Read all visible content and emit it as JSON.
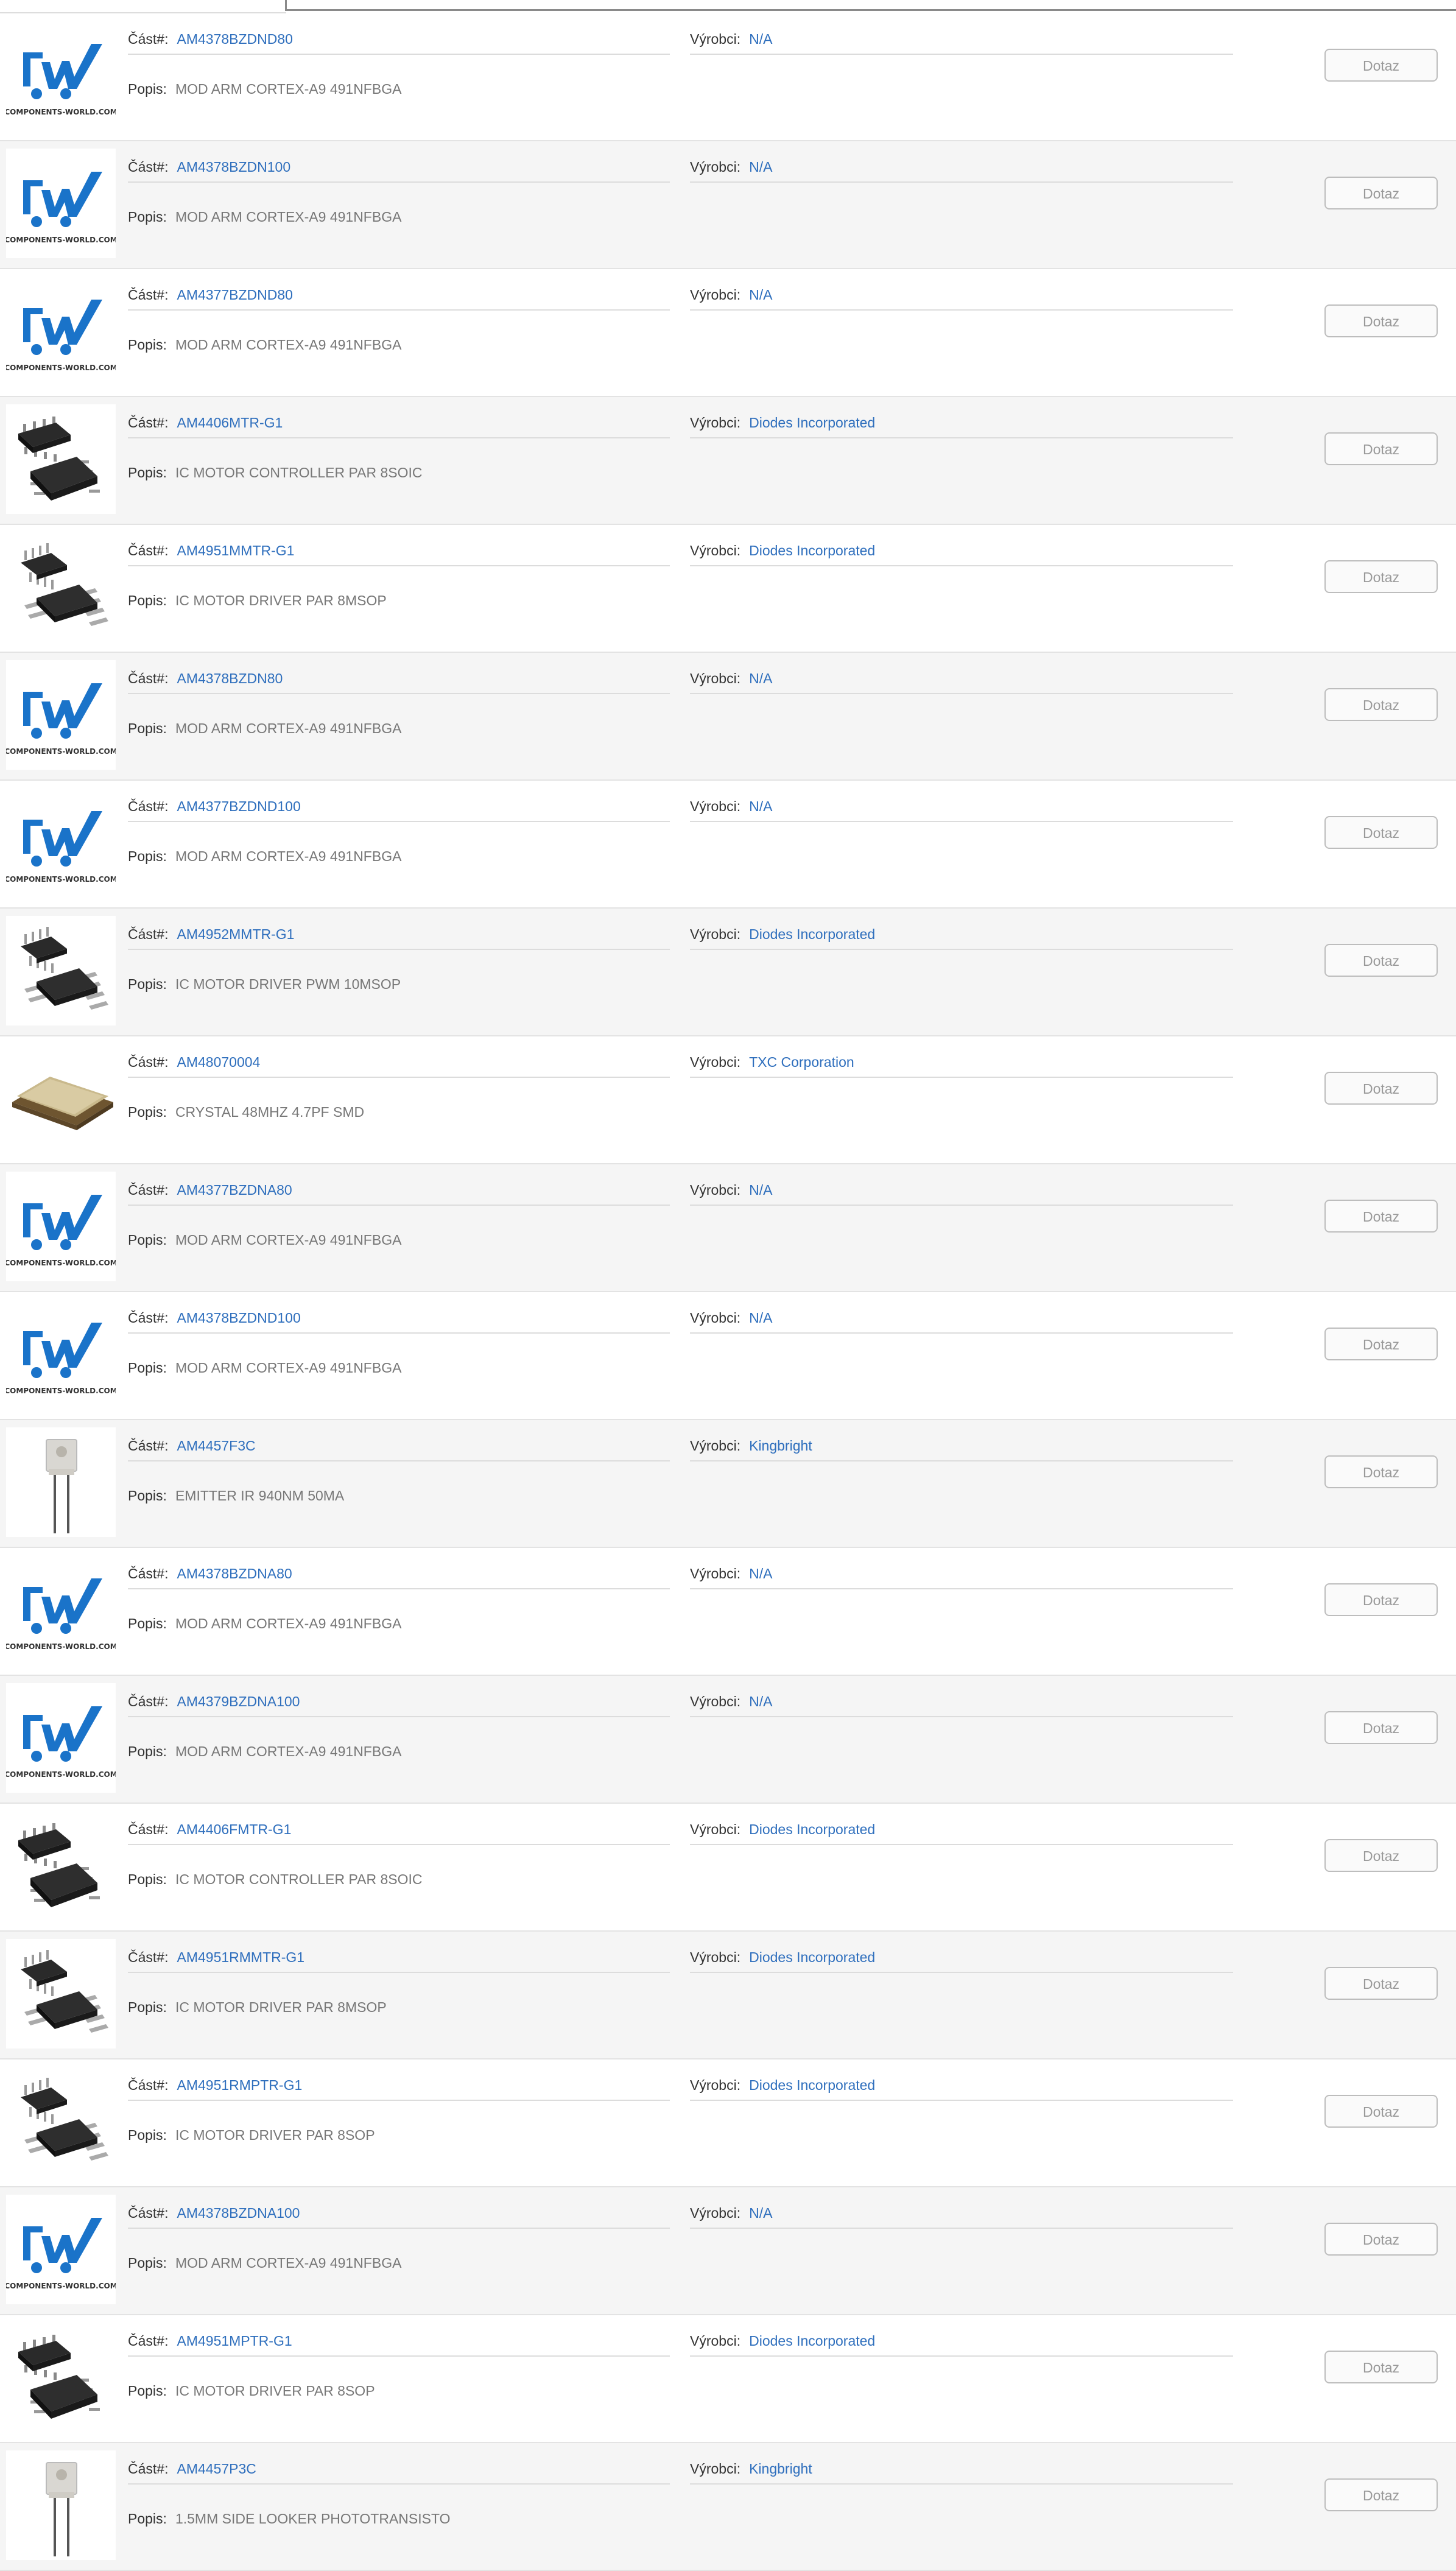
{
  "labels": {
    "part": "Část#:",
    "manufacturer": "Výrobci:",
    "description": "Popis:",
    "inquiry_button": "Dotaz"
  },
  "colors": {
    "link": "#2f6fbd",
    "logo_blue": "#1a73c9",
    "row_alt_bg": "#f5f5f5"
  },
  "products": [
    {
      "image": "components-world-logo",
      "part": "AM4378BZDND80",
      "manufacturer": "N/A",
      "description": "MOD ARM CORTEX-A9 491NFBGA"
    },
    {
      "image": "components-world-logo",
      "part": "AM4378BZDN100",
      "manufacturer": "N/A",
      "description": "MOD ARM CORTEX-A9 491NFBGA"
    },
    {
      "image": "components-world-logo",
      "part": "AM4377BZDND80",
      "manufacturer": "N/A",
      "description": "MOD ARM CORTEX-A9 491NFBGA"
    },
    {
      "image": "soic-chip",
      "part": "AM4406MTR-G1",
      "manufacturer": "Diodes Incorporated",
      "description": "IC MOTOR CONTROLLER PAR 8SOIC"
    },
    {
      "image": "msop-chip",
      "part": "AM4951MMTR-G1",
      "manufacturer": "Diodes Incorporated",
      "description": "IC MOTOR DRIVER PAR 8MSOP"
    },
    {
      "image": "components-world-logo",
      "part": "AM4378BZDN80",
      "manufacturer": "N/A",
      "description": "MOD ARM CORTEX-A9 491NFBGA"
    },
    {
      "image": "components-world-logo",
      "part": "AM4377BZDND100",
      "manufacturer": "N/A",
      "description": "MOD ARM CORTEX-A9 491NFBGA"
    },
    {
      "image": "msop-chip",
      "part": "AM4952MMTR-G1",
      "manufacturer": "Diodes Incorporated",
      "description": "IC MOTOR DRIVER PWM 10MSOP"
    },
    {
      "image": "crystal-oscillator",
      "part": "AM48070004",
      "manufacturer": "TXC Corporation",
      "description": "CRYSTAL 48MHZ 4.7PF SMD"
    },
    {
      "image": "components-world-logo",
      "part": "AM4377BZDNA80",
      "manufacturer": "N/A",
      "description": "MOD ARM CORTEX-A9 491NFBGA"
    },
    {
      "image": "components-world-logo",
      "part": "AM4378BZDND100",
      "manufacturer": "N/A",
      "description": "MOD ARM CORTEX-A9 491NFBGA"
    },
    {
      "image": "ir-emitter",
      "part": "AM4457F3C",
      "manufacturer": "Kingbright",
      "description": "EMITTER IR 940NM 50MA"
    },
    {
      "image": "components-world-logo",
      "part": "AM4378BZDNA80",
      "manufacturer": "N/A",
      "description": "MOD ARM CORTEX-A9 491NFBGA"
    },
    {
      "image": "components-world-logo",
      "part": "AM4379BZDNA100",
      "manufacturer": "N/A",
      "description": "MOD ARM CORTEX-A9 491NFBGA"
    },
    {
      "image": "soic-chip",
      "part": "AM4406FMTR-G1",
      "manufacturer": "Diodes Incorporated",
      "description": "IC MOTOR CONTROLLER PAR 8SOIC"
    },
    {
      "image": "msop-chip",
      "part": "AM4951RMMTR-G1",
      "manufacturer": "Diodes Incorporated",
      "description": "IC MOTOR DRIVER PAR 8MSOP"
    },
    {
      "image": "msop-chip",
      "part": "AM4951RMPTR-G1",
      "manufacturer": "Diodes Incorporated",
      "description": "IC MOTOR DRIVER PAR 8SOP"
    },
    {
      "image": "components-world-logo",
      "part": "AM4378BZDNA100",
      "manufacturer": "N/A",
      "description": "MOD ARM CORTEX-A9 491NFBGA"
    },
    {
      "image": "soic-chip",
      "part": "AM4951MPTR-G1",
      "manufacturer": "Diodes Incorporated",
      "description": "IC MOTOR DRIVER PAR 8SOP"
    },
    {
      "image": "ir-emitter",
      "part": "AM4457P3C",
      "manufacturer": "Kingbright",
      "description": "1.5MM SIDE LOOKER PHOTOTRANSISTO"
    }
  ]
}
